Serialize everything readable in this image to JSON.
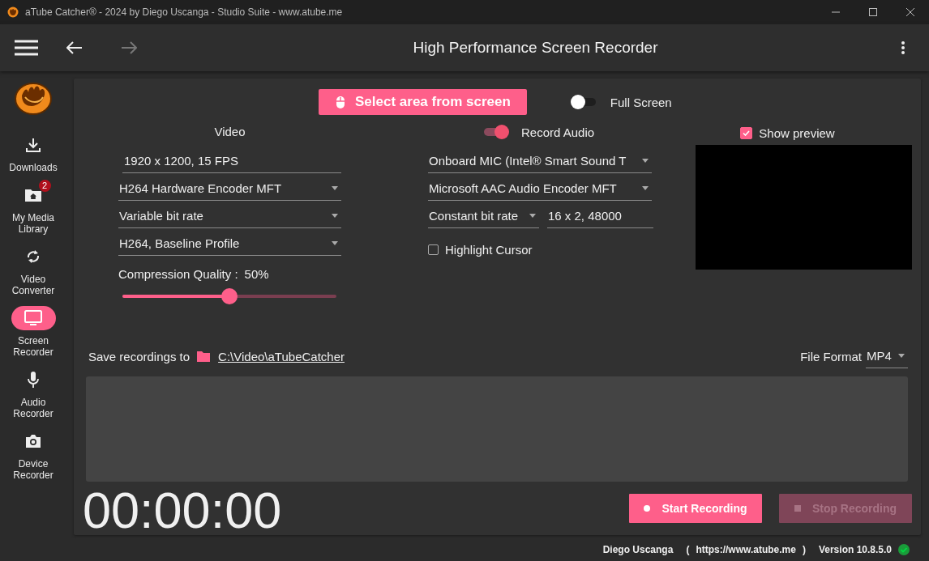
{
  "window": {
    "title": "aTube Catcher® - 2024 by Diego Uscanga - Studio Suite - www.atube.me"
  },
  "header": {
    "title": "High Performance Screen Recorder",
    "back": {
      "disabled": false
    },
    "forward": {
      "disabled": true
    }
  },
  "sidebar": {
    "items": [
      {
        "kind": "download",
        "label": "Downloads",
        "selected": false
      },
      {
        "kind": "library",
        "label": "My Media Library",
        "badge": "2",
        "selected": false
      },
      {
        "kind": "convert",
        "label": "Video Converter",
        "selected": false
      },
      {
        "kind": "screen",
        "label": "Screen Recorder",
        "selected": true
      },
      {
        "kind": "mic",
        "label": "Audio Recorder",
        "selected": false
      },
      {
        "kind": "camera",
        "label": "Device Recorder",
        "selected": false
      }
    ]
  },
  "select_area_button": "Select area from screen",
  "full_screen": {
    "label": "Full Screen",
    "on": false
  },
  "video": {
    "heading": "Video",
    "resolution": "1920 x 1200, 15 FPS",
    "encoder": "H264 Hardware Encoder MFT",
    "bitrate_mode": "Variable bit rate",
    "profile": "H264, Baseline Profile",
    "compression_label": "Compression Quality :",
    "compression_value": "50%",
    "level": 0.5
  },
  "audio": {
    "record_audio": {
      "label": "Record Audio",
      "on": true
    },
    "device": "Onboard MIC (Intel® Smart Sound T",
    "encoder": "Microsoft AAC Audio Encoder MFT",
    "bitrate_mode": "Constant bit rate",
    "format": "16 x 2, 48000"
  },
  "highlight_cursor": {
    "label": "Highlight Cursor",
    "checked": false
  },
  "show_preview": {
    "label": "Show preview",
    "checked": true
  },
  "save": {
    "label": "Save recordings to",
    "path": "C:\\Video\\aTubeCatcher"
  },
  "file_format": {
    "label": "File Format",
    "value": "MP4"
  },
  "timer": "00:00:00",
  "start_button": {
    "label": "Start Recording",
    "disabled": false
  },
  "stop_button": {
    "label": "Stop Recording",
    "disabled": true
  },
  "status_bar": {
    "author": "Diego Uscanga",
    "open_paren": "(",
    "url": "https://www.atube.me",
    "close_paren": ")",
    "version": "Version 10.8.5.0"
  }
}
